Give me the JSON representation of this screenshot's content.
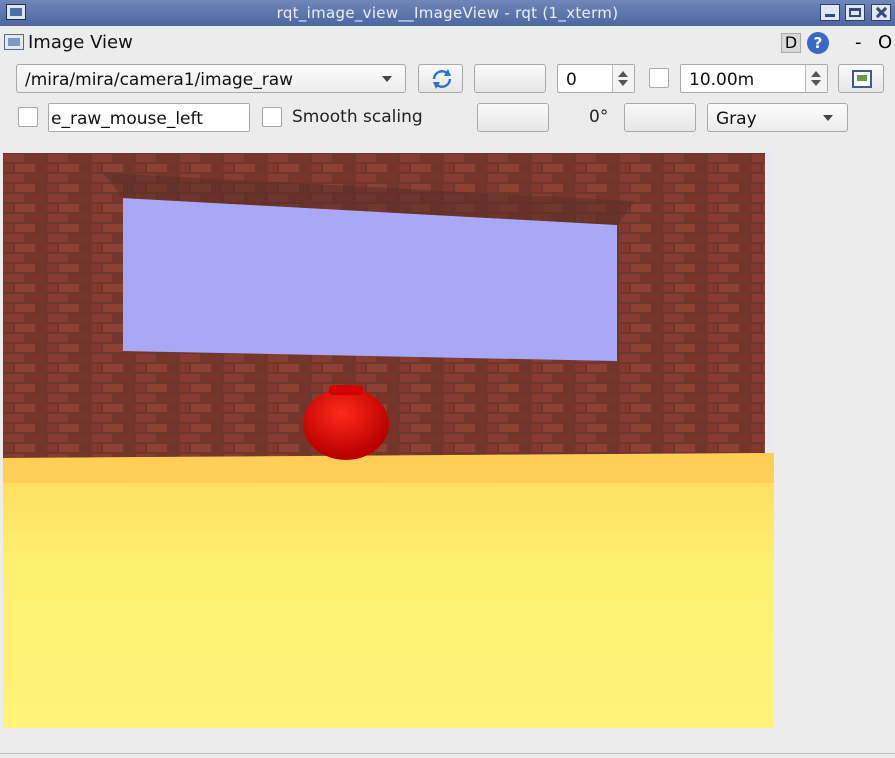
{
  "window": {
    "title": "rqt_image_view__ImageView - rqt (1_xterm)"
  },
  "plugin": {
    "title": "Image View",
    "d_label": "D",
    "help_label": "?",
    "dash_label": "-",
    "o_label": "O"
  },
  "toolbar": {
    "topic": "/mira/mira/camera1/image_raw",
    "blank1": "",
    "spin_value": "0",
    "max_range": "10.00m",
    "mouse_topic": "e_raw_mouse_left",
    "smooth_label": "Smooth scaling",
    "blank2": "",
    "rotation": "0°",
    "blank3": "",
    "color_scheme": "Gray"
  },
  "image": {
    "icon": "camera-image",
    "colors": {
      "sky": "#a9a8f6",
      "floor": "#ffe75a",
      "brick": "#8e3b2e",
      "ball": "#e10000"
    }
  }
}
